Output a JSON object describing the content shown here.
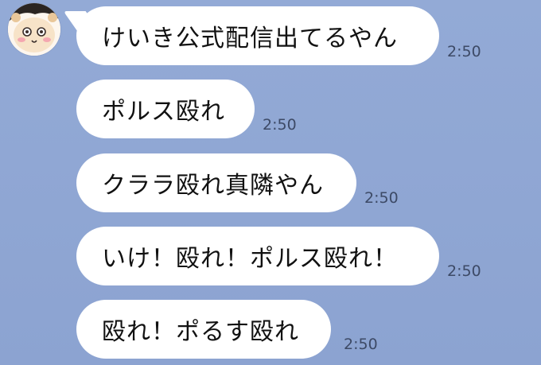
{
  "messages": [
    {
      "text": "けいき公式配信出てるやん",
      "time": "2:50"
    },
    {
      "text": "ポルス殴れ",
      "time": "2:50"
    },
    {
      "text": "クララ殴れ真隣やん",
      "time": "2:50"
    },
    {
      "text": "いけ！殴れ！ポルス殴れ！",
      "time": "2:50"
    },
    {
      "text": "殴れ！ポるす殴れ",
      "time": "2:50"
    }
  ],
  "colors": {
    "background": "#8fa6d3",
    "bubble": "#ffffff",
    "timestamp": "#3d4a66"
  },
  "icons": {
    "avatar": "cartoon-hamster-avatar-icon"
  }
}
